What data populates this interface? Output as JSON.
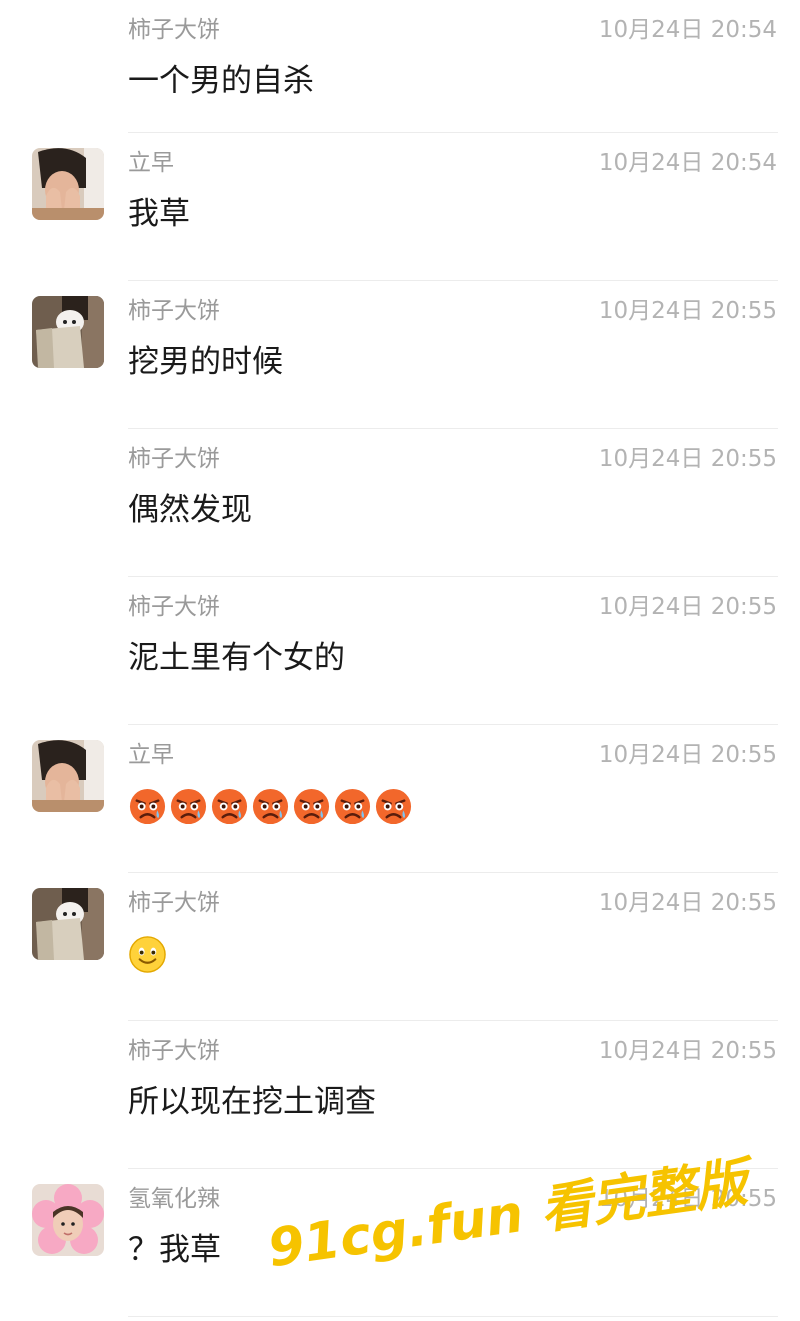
{
  "messages": [
    {
      "sender": "柿子大饼",
      "time": "10月24日 20:54",
      "text": "一个男的自杀",
      "avatar": "none"
    },
    {
      "sender": "立早",
      "time": "10月24日 20:54",
      "text": "我草",
      "avatar": "person-covering-face"
    },
    {
      "sender": "柿子大饼",
      "time": "10月24日 20:55",
      "text": "挖男的时候",
      "avatar": "person-with-white-dog"
    },
    {
      "sender": "柿子大饼",
      "time": "10月24日 20:55",
      "text": "偶然发现",
      "avatar": "none"
    },
    {
      "sender": "柿子大饼",
      "time": "10月24日 20:55",
      "text": "泥土里有个女的",
      "avatar": "none"
    },
    {
      "sender": "立早",
      "time": "10月24日 20:55",
      "text": "",
      "avatar": "person-covering-face",
      "emojis": [
        "crying-angry-face",
        "crying-angry-face",
        "crying-angry-face",
        "crying-angry-face",
        "crying-angry-face",
        "crying-angry-face",
        "crying-angry-face"
      ]
    },
    {
      "sender": "柿子大饼",
      "time": "10月24日 20:55",
      "text": "",
      "avatar": "person-with-white-dog",
      "emojis": [
        "smiling-face"
      ]
    },
    {
      "sender": "柿子大饼",
      "time": "10月24日 20:55",
      "text": "所以现在挖土调查",
      "avatar": "none"
    },
    {
      "sender": "氢氧化辣",
      "time": "10月24日 20:55",
      "text": "？我草",
      "avatar": "person-with-pink-flower-pillow"
    }
  ],
  "watermark": {
    "text": "91cg.fun 看完整版",
    "color": "#f6c300"
  }
}
